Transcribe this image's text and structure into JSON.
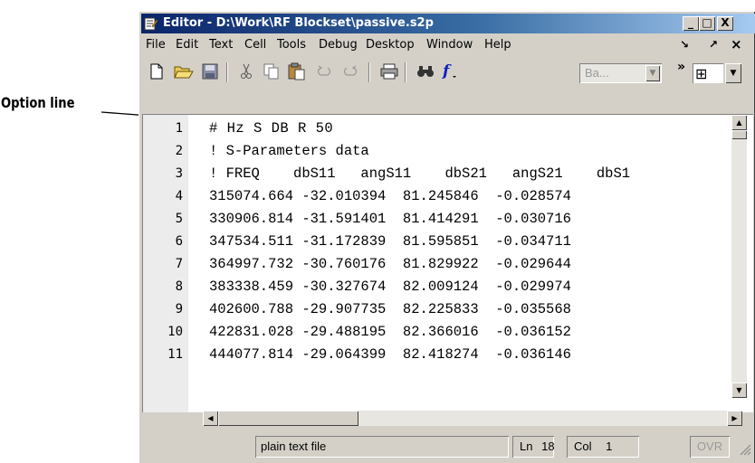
{
  "annotation": {
    "label": "Option line"
  },
  "window": {
    "title": "Editor - D:\\Work\\RF Blockset\\passive.s2p",
    "controls": {
      "minimize": "_",
      "maximize": "□",
      "close": "X"
    }
  },
  "menubar": {
    "items": [
      "File",
      "Edit",
      "Text",
      "Cell",
      "Tools",
      "Debug",
      "Desktop",
      "Window",
      "Help"
    ],
    "dock_label": "↘",
    "undock_label": "↗",
    "close_label": "×"
  },
  "toolbar": {
    "font_combo_value": "Ba...",
    "overflow_label": "»",
    "layout_glyph": "⊞",
    "icons": [
      "new-file-icon",
      "open-file-icon",
      "save-icon",
      "cut-icon",
      "copy-icon",
      "paste-icon",
      "undo-icon",
      "redo-icon",
      "print-icon",
      "find-icon",
      "function-icon"
    ]
  },
  "editor": {
    "lines": [
      {
        "num": "1",
        "text": "# Hz S DB R 50"
      },
      {
        "num": "2",
        "text": "! S-Parameters data"
      },
      {
        "num": "3",
        "text": "! FREQ    dbS11   angS11    dbS21   angS21    dbS1"
      },
      {
        "num": "4",
        "text": "315074.664 -32.010394  81.245846  -0.028574"
      },
      {
        "num": "5",
        "text": "330906.814 -31.591401  81.414291  -0.030716"
      },
      {
        "num": "6",
        "text": "347534.511 -31.172839  81.595851  -0.034711"
      },
      {
        "num": "7",
        "text": "364997.732 -30.760176  81.829922  -0.029644"
      },
      {
        "num": "8",
        "text": "383338.459 -30.327674  82.009124  -0.029974"
      },
      {
        "num": "9",
        "text": "402600.788 -29.907735  82.225833  -0.035568"
      },
      {
        "num": "10",
        "text": "422831.028 -29.488195  82.366016  -0.036152"
      },
      {
        "num": "11",
        "text": "444077.814 -29.064399  82.418274  -0.036146"
      }
    ]
  },
  "statusbar": {
    "file_type": "plain text file",
    "line_label": "Ln",
    "line_value": "18",
    "col_label": "Col",
    "col_value": "1",
    "mode": "OVR"
  }
}
